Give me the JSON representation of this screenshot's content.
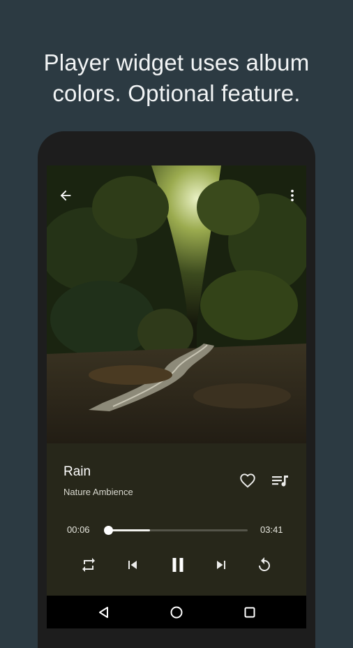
{
  "caption": {
    "line1": "Player widget uses album",
    "line2": "colors. Optional feature."
  },
  "album_art": {
    "icon": "forest-path-photo"
  },
  "top_bar": {
    "back_icon": "arrow-back-icon",
    "menu_icon": "more-vert-icon"
  },
  "player": {
    "track_title": "Rain",
    "artist": "Nature Ambience",
    "elapsed": "00:06",
    "duration": "03:41",
    "progress_fraction": 0.3,
    "accent_color": "#27271a",
    "actions": [
      "favorite-icon",
      "queue-music-icon"
    ],
    "controls": [
      "repeat-icon",
      "skip-previous-icon",
      "pause-icon",
      "skip-next-icon",
      "replay-icon"
    ]
  },
  "navbar": {
    "buttons": [
      "nav-back-icon",
      "nav-home-icon",
      "nav-recents-icon"
    ]
  }
}
